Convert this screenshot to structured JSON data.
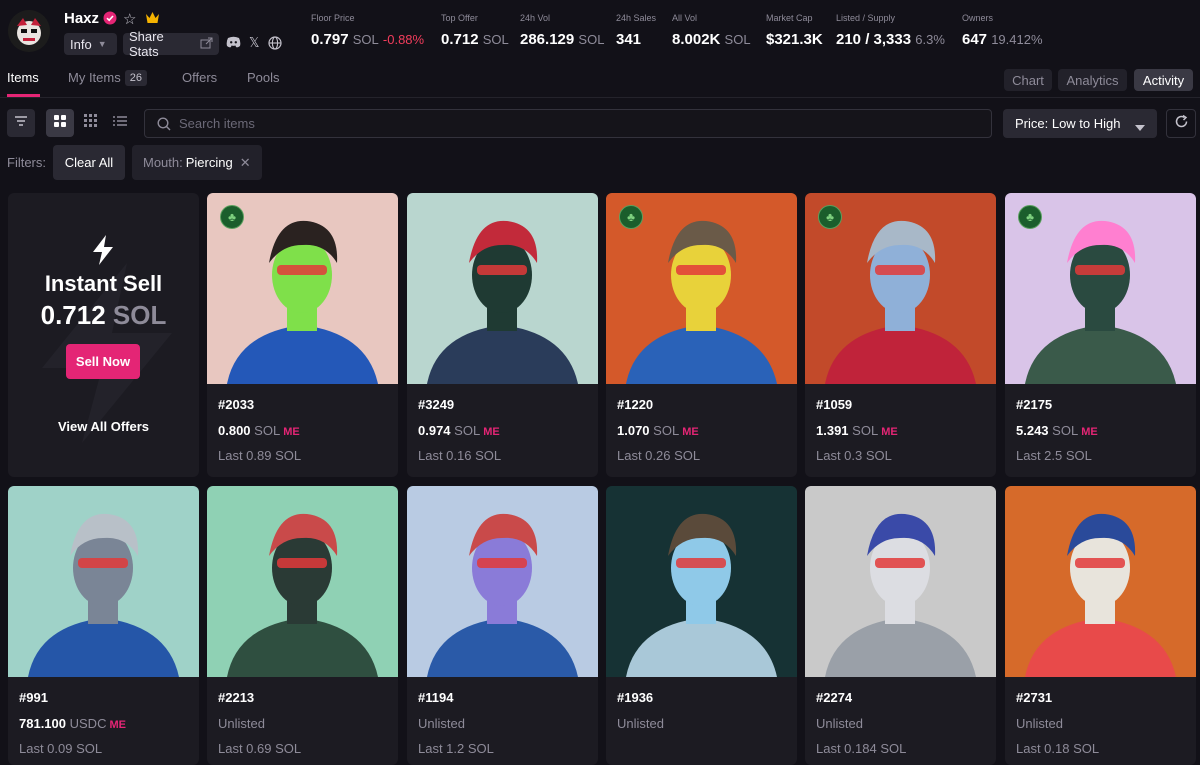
{
  "collection": {
    "name": "Haxz",
    "info_label": "Info",
    "share_label": "Share Stats"
  },
  "stats": [
    {
      "label": "Floor Price",
      "value": "0.797",
      "unit": "SOL",
      "change": "-0.88%"
    },
    {
      "label": "Top Offer",
      "value": "0.712",
      "unit": "SOL"
    },
    {
      "label": "24h Vol",
      "value": "286.129",
      "unit": "SOL"
    },
    {
      "label": "24h Sales",
      "value": "341"
    },
    {
      "label": "All Vol",
      "value": "8.002K",
      "unit": "SOL"
    },
    {
      "label": "Market Cap",
      "value": "$321.3K"
    },
    {
      "label": "Listed / Supply",
      "value": "210 / 3,333",
      "extra": "6.3%"
    },
    {
      "label": "Owners",
      "value": "647",
      "extra": "19.412%"
    }
  ],
  "tabs": {
    "items": "Items",
    "my_items": "My Items",
    "my_items_count": "26",
    "offers": "Offers",
    "pools": "Pools"
  },
  "view_tabs": {
    "chart": "Chart",
    "analytics": "Analytics",
    "activity": "Activity"
  },
  "search": {
    "placeholder": "Search items"
  },
  "sort": {
    "value": "Price: Low to High"
  },
  "filters": {
    "label": "Filters:",
    "clear_all": "Clear All",
    "chip_trait": "Mouth:",
    "chip_value": "Piercing"
  },
  "instant_sell": {
    "title": "Instant Sell",
    "price": "0.712",
    "unit": "SOL",
    "button": "Sell Now",
    "view_all": "View All Offers"
  },
  "colors": {
    "accent": "#e42575",
    "negative": "#f23d5c",
    "background": "#121118"
  },
  "cards": [
    {
      "number": "#2033",
      "price": "0.800",
      "unit": "SOL",
      "last": "Last 0.89 SOL",
      "lucky": true,
      "bg": "#e8c7c0"
    },
    {
      "number": "#3249",
      "price": "0.974",
      "unit": "SOL",
      "last": "Last 0.16 SOL",
      "lucky": false,
      "bg": "#b9d6cf"
    },
    {
      "number": "#1220",
      "price": "1.070",
      "unit": "SOL",
      "last": "Last 0.26 SOL",
      "lucky": true,
      "bg": "#d4592a"
    },
    {
      "number": "#1059",
      "price": "1.391",
      "unit": "SOL",
      "last": "Last 0.3 SOL",
      "lucky": true,
      "bg": "#c24a2a"
    },
    {
      "number": "#2175",
      "price": "5.243",
      "unit": "SOL",
      "last": "Last 2.5 SOL",
      "lucky": true,
      "bg": "#d9c4e8"
    },
    {
      "number": "#991",
      "price": "781.100",
      "unit": "USDC",
      "last": "Last 0.09 SOL",
      "lucky": false,
      "bg": "#9fd2c8"
    },
    {
      "number": "#2213",
      "status": "Unlisted",
      "last": "Last 0.69 SOL",
      "lucky": false,
      "bg": "#8fd1b4"
    },
    {
      "number": "#1194",
      "status": "Unlisted",
      "last": "Last 1.2 SOL",
      "lucky": false,
      "bg": "#b9cbe3"
    },
    {
      "number": "#1936",
      "status": "Unlisted",
      "last": "",
      "lucky": false,
      "bg": "#163234"
    },
    {
      "number": "#2274",
      "status": "Unlisted",
      "last": "Last 0.184 SOL",
      "lucky": false,
      "bg": "#c9c9c9"
    },
    {
      "number": "#2731",
      "status": "Unlisted",
      "last": "Last 0.18 SOL",
      "lucky": false,
      "bg": "#d66a2a"
    }
  ]
}
